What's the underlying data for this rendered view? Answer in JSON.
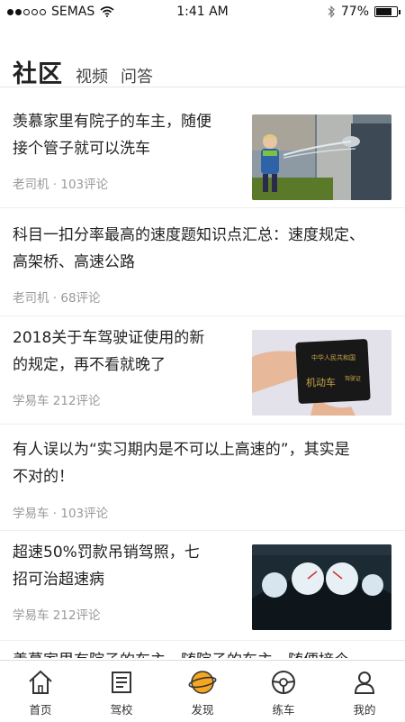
{
  "status_bar": {
    "carrier": "SEMAS",
    "time": "1:41 AM",
    "battery": "77%",
    "battery_level": 0.77,
    "signal_dots": 2
  },
  "tabs": {
    "active": "社区",
    "items": [
      "视频",
      "问答"
    ]
  },
  "feed": [
    {
      "title_lines": [
        "羡慕家里有院子的车主，随便",
        "接个管子就可以洗车"
      ],
      "author": "老司机",
      "comments": "103评论",
      "meta": "老司机 · 103评论",
      "thumb": "boy-washing-car"
    },
    {
      "title_lines": [
        "科目一扣分率最高的速度题知识点汇总：速度规定、",
        "高架桥、高速公路"
      ],
      "author": "老司机",
      "comments": "68评论",
      "meta": "老司机 · 68评论",
      "thumb": null
    },
    {
      "title_lines": [
        "2018关于车驾驶证使用的新",
        "的规定，再不看就晚了"
      ],
      "author": "学易车",
      "comments": "212评论",
      "meta": "学易车  212评论",
      "thumb": "driving-license"
    },
    {
      "title_lines": [
        "有人误以为“实习期内是不可以上高速的”，其实是",
        "不对的！"
      ],
      "author": "学易车",
      "comments": "103评论",
      "meta": "学易车 · 103评论",
      "thumb": null
    },
    {
      "title_lines": [
        "超速50%罚款吊销驾照，七",
        "招可治超速病"
      ],
      "author": "学易车",
      "comments": "212评论",
      "meta": "学易车  212评论",
      "thumb": "dashboard"
    },
    {
      "title_lines": [
        "羡慕家里有院子的车主，随院子的车主，随便接个"
      ],
      "author": "",
      "comments": "",
      "meta": "",
      "thumb": null
    }
  ],
  "license_text": {
    "top": "中华人民共和国",
    "main": "机动车",
    "side": "驾驶证"
  },
  "bottom_nav": [
    {
      "label": "首页",
      "icon": "home-icon"
    },
    {
      "label": "驾校",
      "icon": "school-icon"
    },
    {
      "label": "发现",
      "icon": "planet-icon",
      "active": true
    },
    {
      "label": "练车",
      "icon": "steering-wheel-icon"
    },
    {
      "label": "我的",
      "icon": "user-icon"
    }
  ],
  "colors": {
    "accent": "#f5a623",
    "text": "#222222",
    "meta": "#999999"
  }
}
